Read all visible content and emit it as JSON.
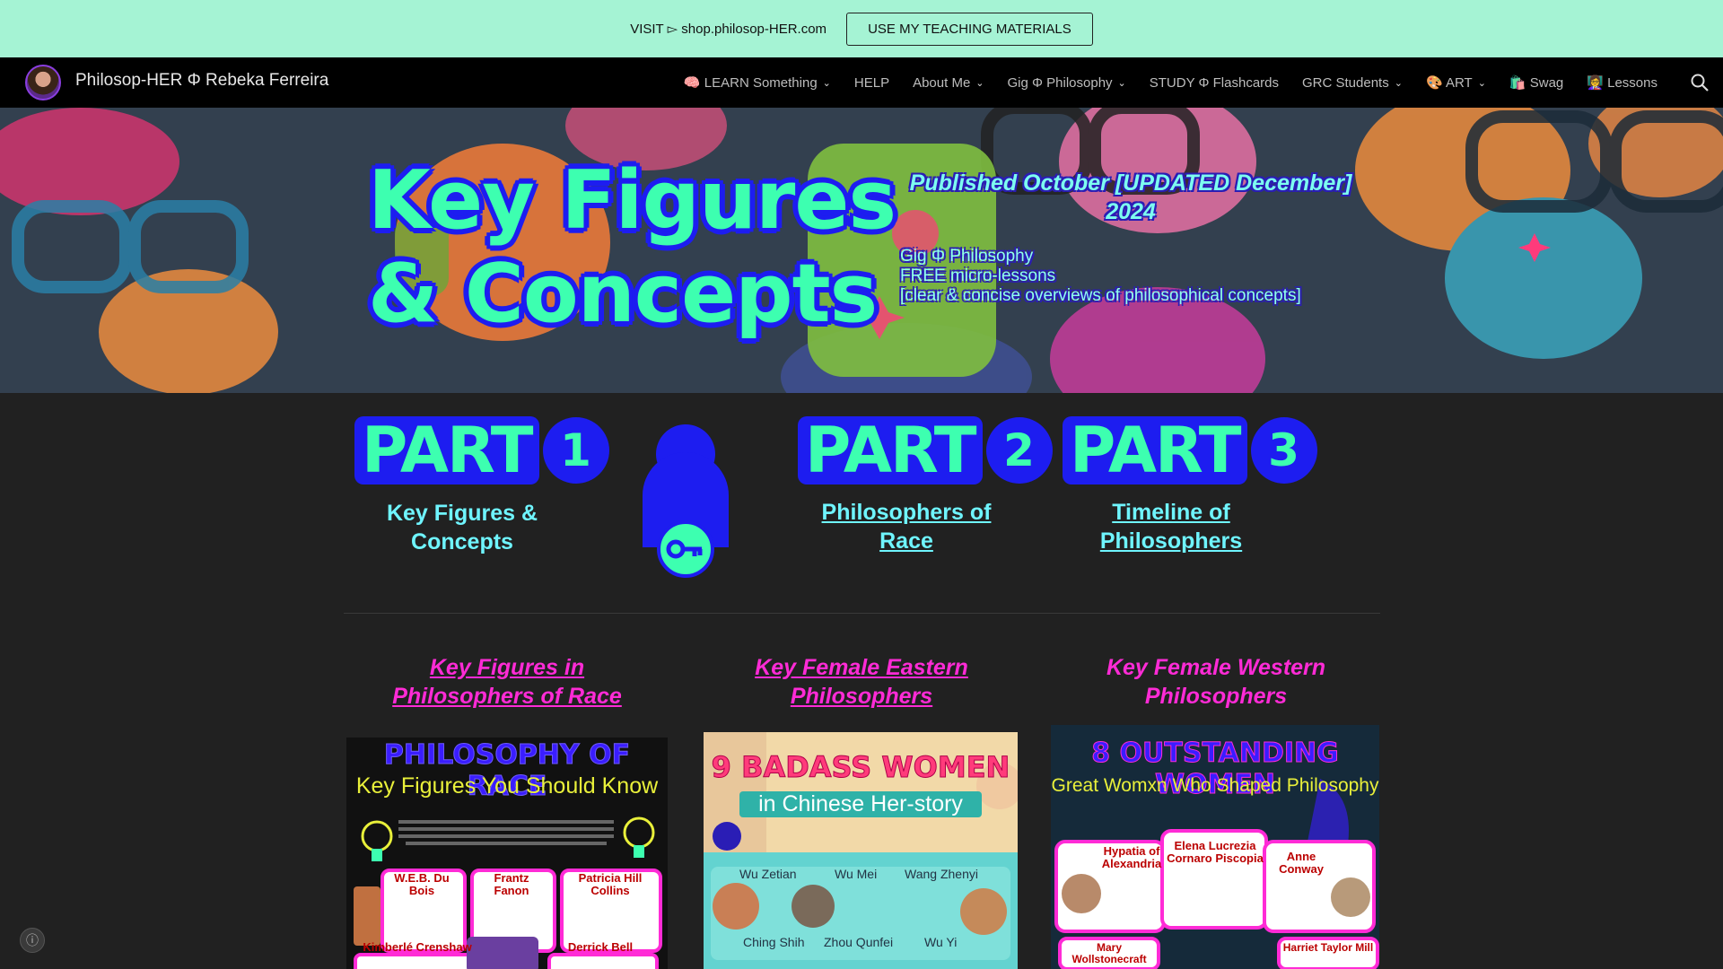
{
  "banner": {
    "text": "VISIT ▻ shop.philosop-HER.com",
    "button": "USE MY TEACHING MATERIALS"
  },
  "site": {
    "title": "Philosop-HER Φ Rebeka Ferreira"
  },
  "menu": [
    {
      "label": "🧠 LEARN Something",
      "has_dropdown": true
    },
    {
      "label": "HELP",
      "has_dropdown": false
    },
    {
      "label": "About Me",
      "has_dropdown": true
    },
    {
      "label": "Gig Φ Philosophy",
      "has_dropdown": true
    },
    {
      "label": "STUDY Φ Flashcards",
      "has_dropdown": false
    },
    {
      "label": "GRC Students",
      "has_dropdown": true
    },
    {
      "label": "🎨 ART",
      "has_dropdown": true
    },
    {
      "label": "🛍️ Swag",
      "has_dropdown": false
    },
    {
      "label": "👩‍🏫 Lessons",
      "has_dropdown": false
    }
  ],
  "hero": {
    "title_line1": "Key Figures",
    "title_line2": "& Concepts",
    "published": "Published October [UPDATED December] 2024",
    "sub_line1": "Gig Φ Philosophy",
    "sub_line2": "FREE micro-lessons",
    "sub_line3": "[clear & concise overviews of philosophical concepts]"
  },
  "parts": [
    {
      "word": "PART",
      "num": "1",
      "label": "Key Figures & Concepts",
      "is_link": false
    },
    {
      "word": "PART",
      "num": "2",
      "label": "Philosophers of Race",
      "is_link": true
    },
    {
      "word": "PART",
      "num": "3",
      "label": "Timeline of Philosophers",
      "is_link": true
    }
  ],
  "columns": [
    {
      "title": "Key Figures in Philosophers of Race",
      "is_link": true
    },
    {
      "title": "Key Female Eastern Philosophers",
      "is_link": true
    },
    {
      "title": "Key Female Western Philosophers",
      "is_link": false
    }
  ],
  "posters": {
    "race": {
      "heading": "PHILOSOPHY OF RACE",
      "subheading": "Key Figures You Should Know",
      "names": [
        "W.E.B. Du Bois",
        "Frantz Fanon",
        "Patricia Hill Collins",
        "Kimberlé Crenshaw",
        "Derrick Bell"
      ]
    },
    "eastern": {
      "heading": "9 BADASS WOMEN",
      "subheading": "in Chinese Her-story",
      "names": [
        "Wu Zetian",
        "Wu Mei",
        "Wang Zhenyi",
        "Ching Shih",
        "Zhou Qunfei",
        "Wu Yi"
      ]
    },
    "western": {
      "heading": "8 OUTSTANDING WOMEN",
      "subheading": "Great Womxn Who Shaped Philosophy",
      "names": [
        "Hypatia of Alexandria",
        "Elena Lucrezia Cornaro Piscopia",
        "Anne Conway",
        "Mary Wollstonecraft",
        "Harriet Taylor Mill"
      ]
    }
  },
  "colors": {
    "banner_bg": "#a5f3d4",
    "accent_green": "#3dffb0",
    "accent_blue": "#1d1df0",
    "accent_pink": "#ff2bd6",
    "accent_cyan": "#6ff5ff"
  }
}
